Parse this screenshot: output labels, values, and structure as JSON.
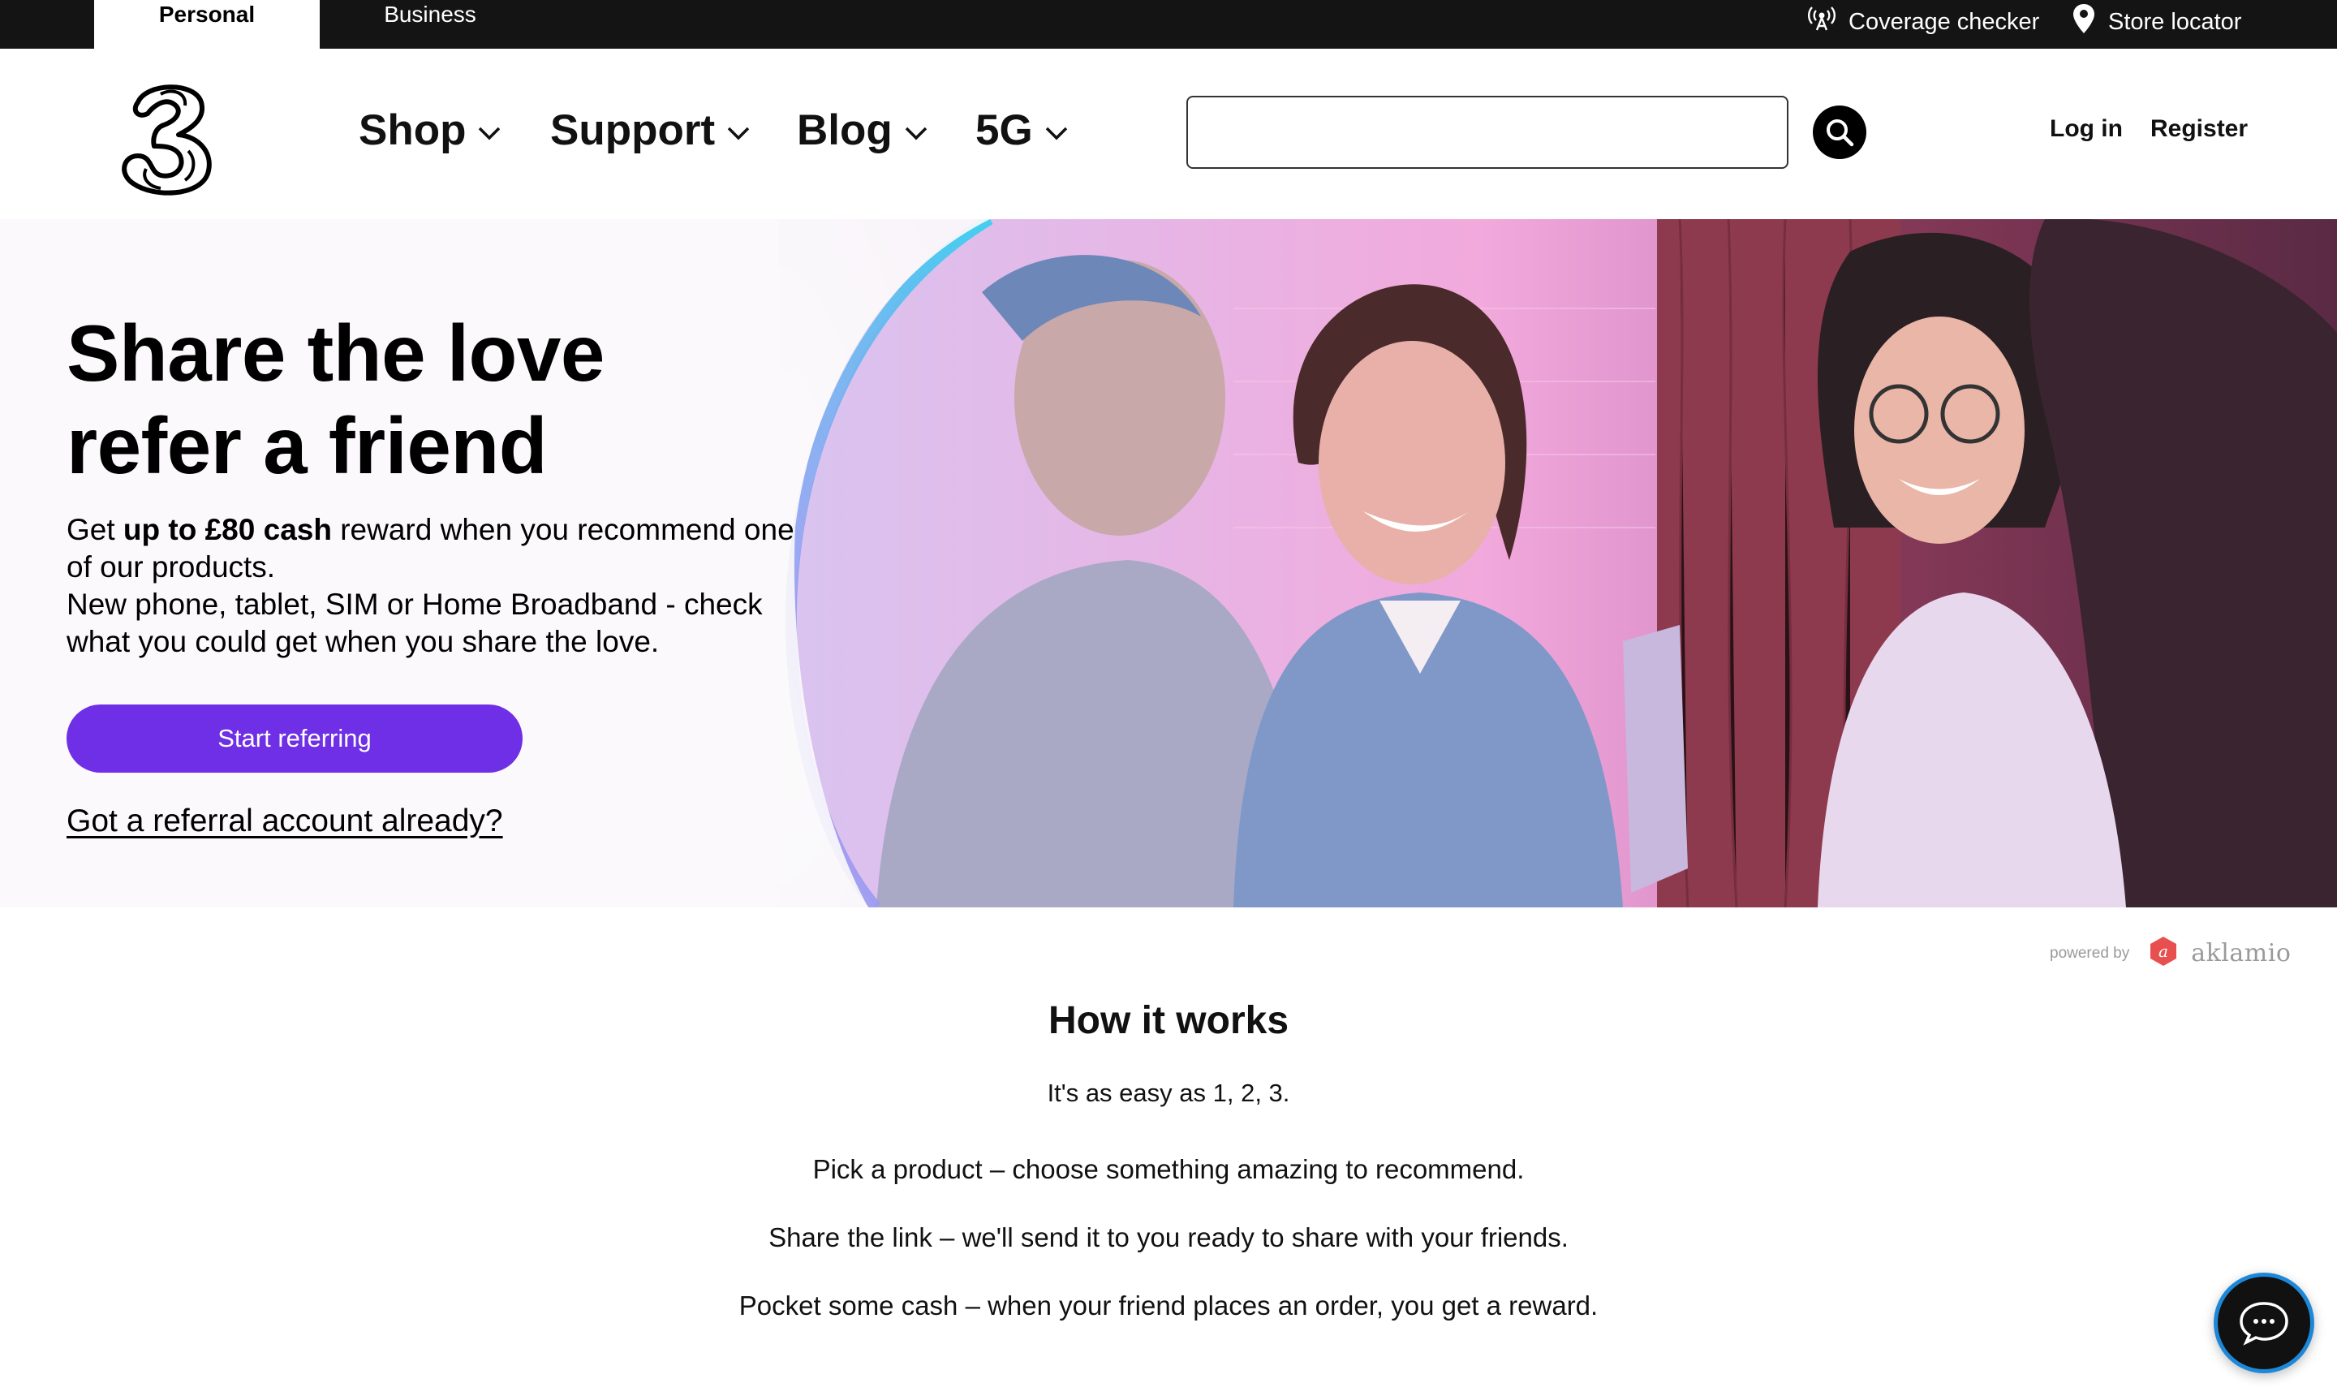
{
  "topbar": {
    "segment_personal": "Personal",
    "segment_business": "Business",
    "coverage_checker": "Coverage checker",
    "store_locator": "Store locator"
  },
  "header": {
    "logo_icon": "three-logo-icon",
    "nav": [
      {
        "label": "Shop"
      },
      {
        "label": "Support"
      },
      {
        "label": "Blog"
      },
      {
        "label": "5G"
      }
    ],
    "search": {
      "placeholder": "",
      "value": "",
      "icon": "search-icon"
    },
    "login": "Log in",
    "register": "Register"
  },
  "hero": {
    "title_line1": "Share the love",
    "title_line2": "refer a friend",
    "text_prefix": "Get ",
    "text_bold": "up to £80 cash",
    "text_after_bold": " reward when you recommend one of our products.",
    "text_line2": "New phone, tablet, SIM or Home Broadband - check what you could get when you share the love.",
    "cta_label": "Start referring",
    "account_link": "Got a referral account already?"
  },
  "powered_by": {
    "label": "powered by",
    "brand": "aklamio",
    "brand_color": "#e8504f"
  },
  "how_it_works": {
    "title": "How it works",
    "subtitle": "It's as easy as 1, 2, 3.",
    "steps": [
      "Pick a product – choose something amazing to recommend.",
      "Share the link – we'll send it to you ready to share with your friends.",
      "Pocket some cash – when your friend places an order, you get a reward."
    ]
  },
  "chat": {
    "icon": "chat-bubble-icon"
  },
  "colors": {
    "accent": "#6e2fe6",
    "topbar": "#141414",
    "chat_ring": "#1e88d8"
  }
}
